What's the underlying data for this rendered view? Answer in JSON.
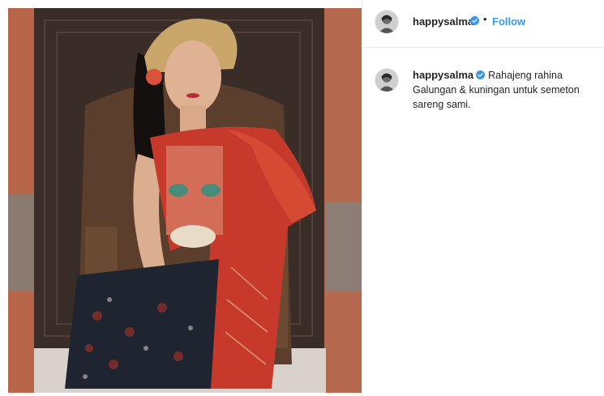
{
  "post": {
    "username": "happysalma",
    "verified": true,
    "separator": "•",
    "follow_label": "Follow",
    "caption": "Rahajeng rahina Galungan & kuningan untuk semeton sareng sami."
  },
  "icons": {
    "verified": "verified-badge-icon",
    "avatar": "profile-avatar"
  },
  "colors": {
    "follow_blue": "#3897f0",
    "verified_blue": "#3897f0",
    "text": "#262626",
    "divider": "#efefef"
  }
}
